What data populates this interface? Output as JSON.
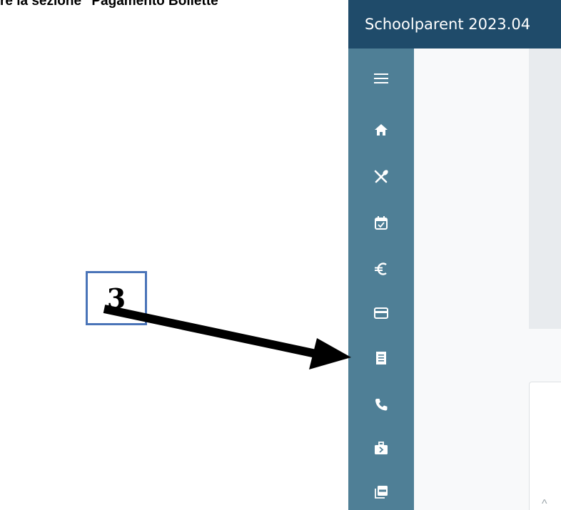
{
  "instruction": {
    "text": "re la sezione \"Pagamento Bollette\""
  },
  "app": {
    "title": "Schoolparent 2023.04",
    "sidebar": {
      "items": [
        {
          "icon": "menu-icon"
        },
        {
          "icon": "home-icon"
        },
        {
          "icon": "fork-knife-icon"
        },
        {
          "icon": "calendar-check-icon"
        },
        {
          "icon": "euro-icon"
        },
        {
          "icon": "credit-card-icon"
        },
        {
          "icon": "receipt-icon"
        },
        {
          "icon": "phone-icon"
        },
        {
          "icon": "briefcase-icon"
        },
        {
          "icon": "pdf-icon"
        }
      ]
    },
    "card": {
      "caret": "^"
    }
  },
  "callout": {
    "step": "3"
  },
  "colors": {
    "header": "#1f4b6a",
    "sidebar": "#4f7f96",
    "panel": "#e8ebee",
    "callout_border": "#4a74b8"
  }
}
